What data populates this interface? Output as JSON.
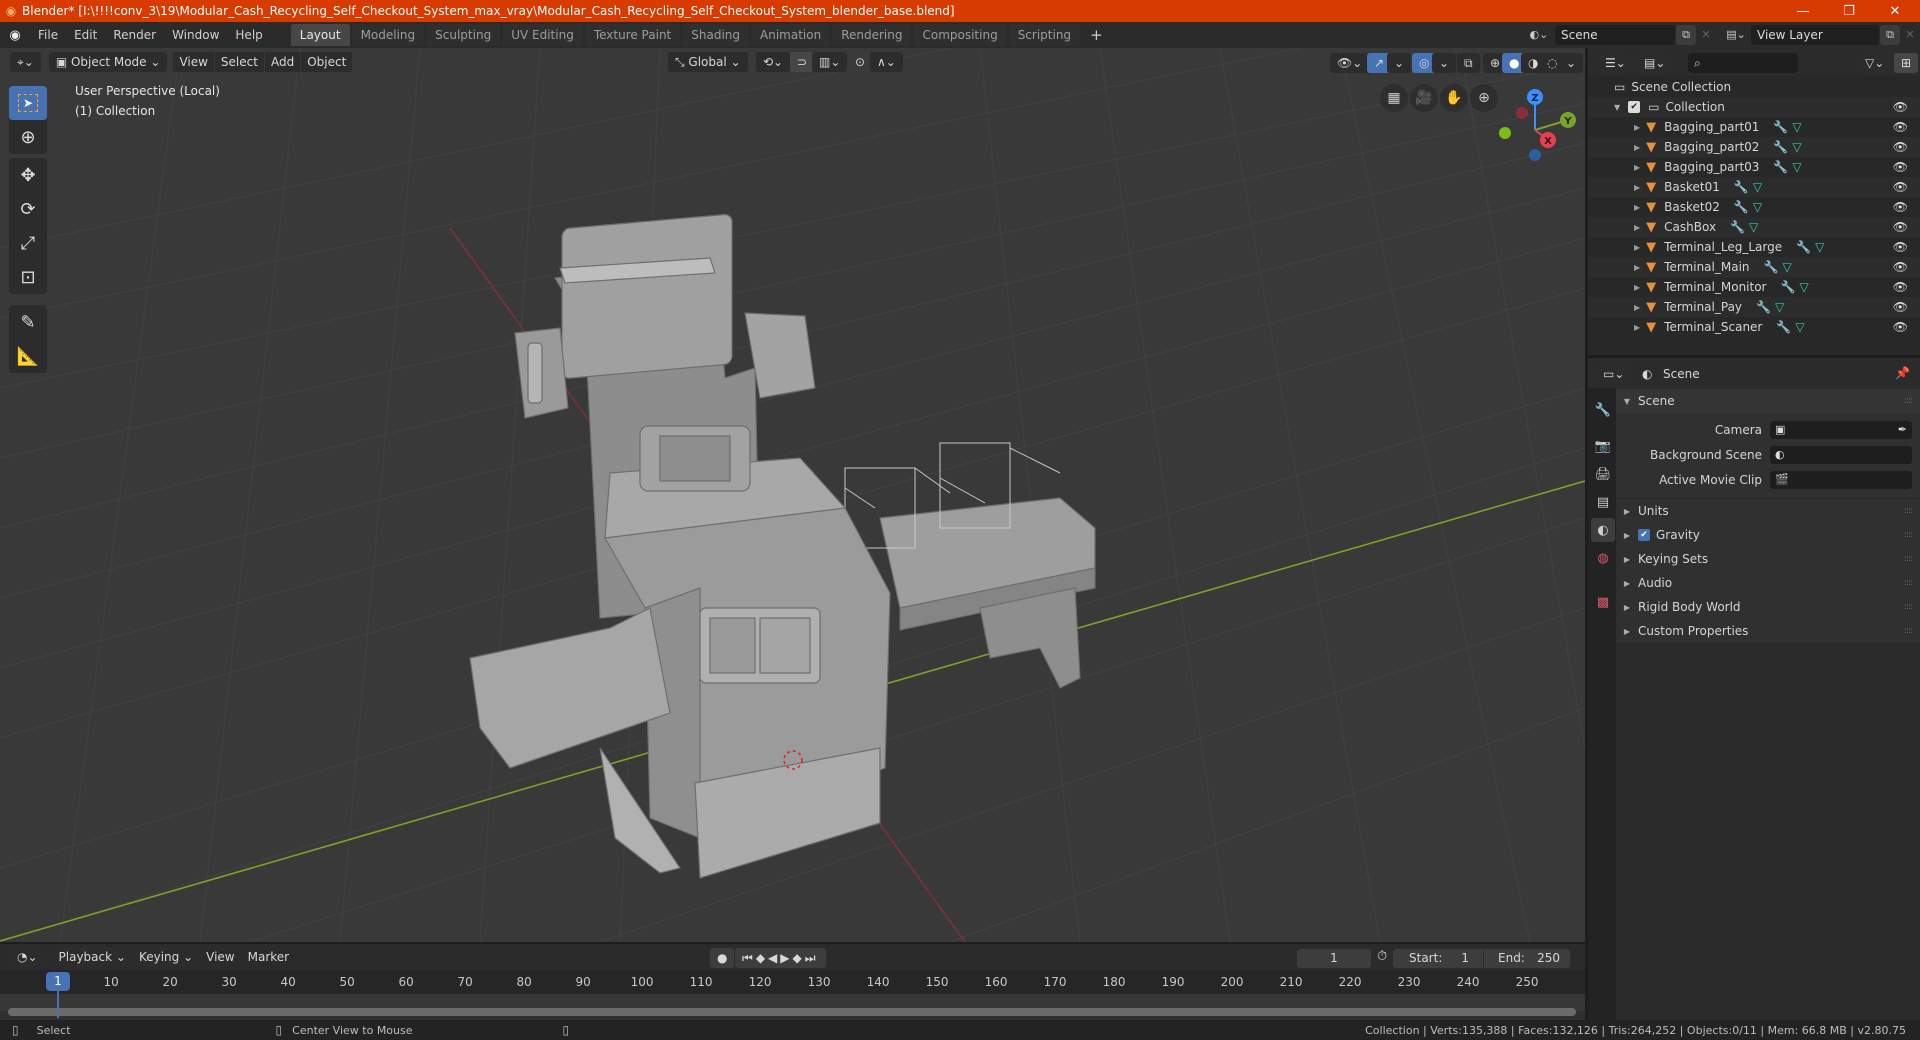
{
  "window": {
    "title": "Blender* [I:\\!!!!conv_3\\19\\Modular_Cash_Recycling_Self_Checkout_System_max_vray\\Modular_Cash_Recycling_Self_Checkout_System_blender_base.blend]",
    "controls": {
      "minimize": "—",
      "maximize": "❐",
      "close": "✕"
    }
  },
  "menubar": {
    "items": [
      "File",
      "Edit",
      "Render",
      "Window",
      "Help"
    ]
  },
  "workspaces": {
    "tabs": [
      "Layout",
      "Modeling",
      "Sculpting",
      "UV Editing",
      "Texture Paint",
      "Shading",
      "Animation",
      "Rendering",
      "Compositing",
      "Scripting"
    ],
    "active": "Layout",
    "add": "+"
  },
  "scene_selector": {
    "value": "Scene"
  },
  "view_layer_selector": {
    "value": "View Layer"
  },
  "viewport": {
    "header": {
      "mode": "Object Mode",
      "menus": [
        "View",
        "Select",
        "Add",
        "Object"
      ],
      "orientation": "Global"
    },
    "overlay": {
      "perspective": "User Perspective (Local)",
      "collection": "(1) Collection"
    },
    "gizmo": {
      "x": "X",
      "y": "Y",
      "z": "Z"
    },
    "colors": {
      "background": "#393939",
      "x_axis": "#c43a44",
      "y_axis": "#7aa32a",
      "model": "#9a9a9a"
    }
  },
  "toolbar": {
    "tools": [
      "select-box",
      "cursor",
      "move",
      "rotate",
      "scale",
      "transform",
      "annotate",
      "measure"
    ],
    "active": "select-box"
  },
  "timeline": {
    "menus": [
      "Playback",
      "Keying",
      "View",
      "Marker"
    ],
    "current_frame": "1",
    "start_label": "Start:",
    "start": "1",
    "end_label": "End:",
    "end": "250",
    "ticks": [
      "10",
      "20",
      "30",
      "40",
      "50",
      "60",
      "70",
      "80",
      "90",
      "100",
      "110",
      "120",
      "130",
      "140",
      "150",
      "160",
      "170",
      "180",
      "190",
      "200",
      "210",
      "220",
      "230",
      "240",
      "250"
    ],
    "playhead": "1"
  },
  "statusbar": {
    "left_action": "Select",
    "middle_action": "Center View to Mouse",
    "stats": "Collection | Verts:135,388 | Faces:132,126 | Tris:264,252 | Objects:0/11 | Mem: 66.8 MB | v2.80.75"
  },
  "outliner": {
    "root": "Scene Collection",
    "collection": "Collection",
    "objects": [
      {
        "name": "Bagging_part01"
      },
      {
        "name": "Bagging_part02"
      },
      {
        "name": "Bagging_part03"
      },
      {
        "name": "Basket01"
      },
      {
        "name": "Basket02"
      },
      {
        "name": "CashBox"
      },
      {
        "name": "Terminal_Leg_Large"
      },
      {
        "name": "Terminal_Main"
      },
      {
        "name": "Terminal_Monitor"
      },
      {
        "name": "Terminal_Pay"
      },
      {
        "name": "Terminal_Scaner"
      }
    ]
  },
  "properties": {
    "context": "Scene",
    "section_scene": "Scene",
    "fields": [
      {
        "label": "Camera",
        "value": ""
      },
      {
        "label": "Background Scene",
        "value": ""
      },
      {
        "label": "Active Movie Clip",
        "value": ""
      }
    ],
    "collapsed_sections": [
      "Units",
      "Gravity",
      "Keying Sets",
      "Audio",
      "Rigid Body World",
      "Custom Properties"
    ],
    "gravity_checked": true
  }
}
